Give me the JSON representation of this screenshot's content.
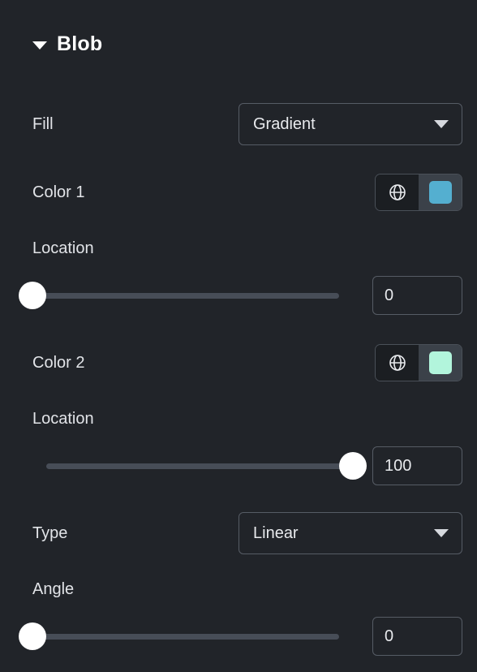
{
  "panel": {
    "background_color": "#212429",
    "section": {
      "title": "Blob",
      "expanded": true,
      "disclosure_icon": "triangle-down-icon"
    }
  },
  "fields": {
    "fill": {
      "label": "Fill",
      "control": "dropdown",
      "value": "Gradient",
      "arrow_icon": "chevron-down-icon"
    },
    "color1": {
      "label": "Color 1",
      "globe_icon": "globe-icon",
      "swatch_color": "#54AFD0"
    },
    "location1": {
      "label": "Location",
      "value": "0",
      "slider_position": "start",
      "min": 0,
      "max": 100
    },
    "color2": {
      "label": "Color 2",
      "globe_icon": "globe-icon",
      "swatch_color": "#B2F5DC"
    },
    "location2": {
      "label": "Location",
      "value": "100",
      "slider_position": "end",
      "min": 0,
      "max": 100
    },
    "type": {
      "label": "Type",
      "control": "dropdown",
      "value": "Linear",
      "arrow_icon": "chevron-down-icon"
    },
    "angle": {
      "label": "Angle",
      "value": "0",
      "slider_position": "start",
      "min": 0,
      "max": 360
    }
  }
}
